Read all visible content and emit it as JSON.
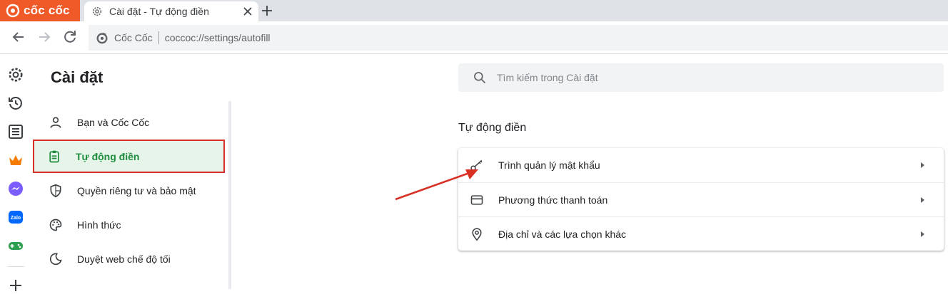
{
  "browser": {
    "brand_name": "cốc cốc",
    "tab_title": "Cài đặt - Tự động điền",
    "site_name": "Cốc Cốc",
    "url": "coccoc://settings/autofill"
  },
  "colors": {
    "brand": "#f05a28",
    "active_green": "#1e8e3e",
    "highlight_red": "#d93025"
  },
  "rail": {
    "icons": [
      "gear-icon",
      "history-icon",
      "list-icon",
      "crown-icon",
      "messenger-icon",
      "zalo-icon",
      "gamepad-icon",
      "plus-icon"
    ]
  },
  "settings": {
    "title": "Cài đặt",
    "menu": [
      {
        "label": "Bạn và Cốc Cốc",
        "icon": "person-icon"
      },
      {
        "label": "Tự động điền",
        "icon": "clipboard-icon",
        "active": true
      },
      {
        "label": "Quyền riêng tư và bảo mật",
        "icon": "shield-icon"
      },
      {
        "label": "Hình thức",
        "icon": "palette-icon"
      },
      {
        "label": "Duyệt web chế độ tối",
        "icon": "moon-icon"
      }
    ]
  },
  "search": {
    "placeholder": "Tìm kiếm trong Cài đặt"
  },
  "section": {
    "title": "Tự động điền",
    "rows": [
      {
        "label": "Trình quản lý mật khẩu",
        "icon": "key-icon"
      },
      {
        "label": "Phương thức thanh toán",
        "icon": "credit-card-icon"
      },
      {
        "label": "Địa chỉ và các lựa chọn khác",
        "icon": "location-pin-icon"
      }
    ]
  }
}
